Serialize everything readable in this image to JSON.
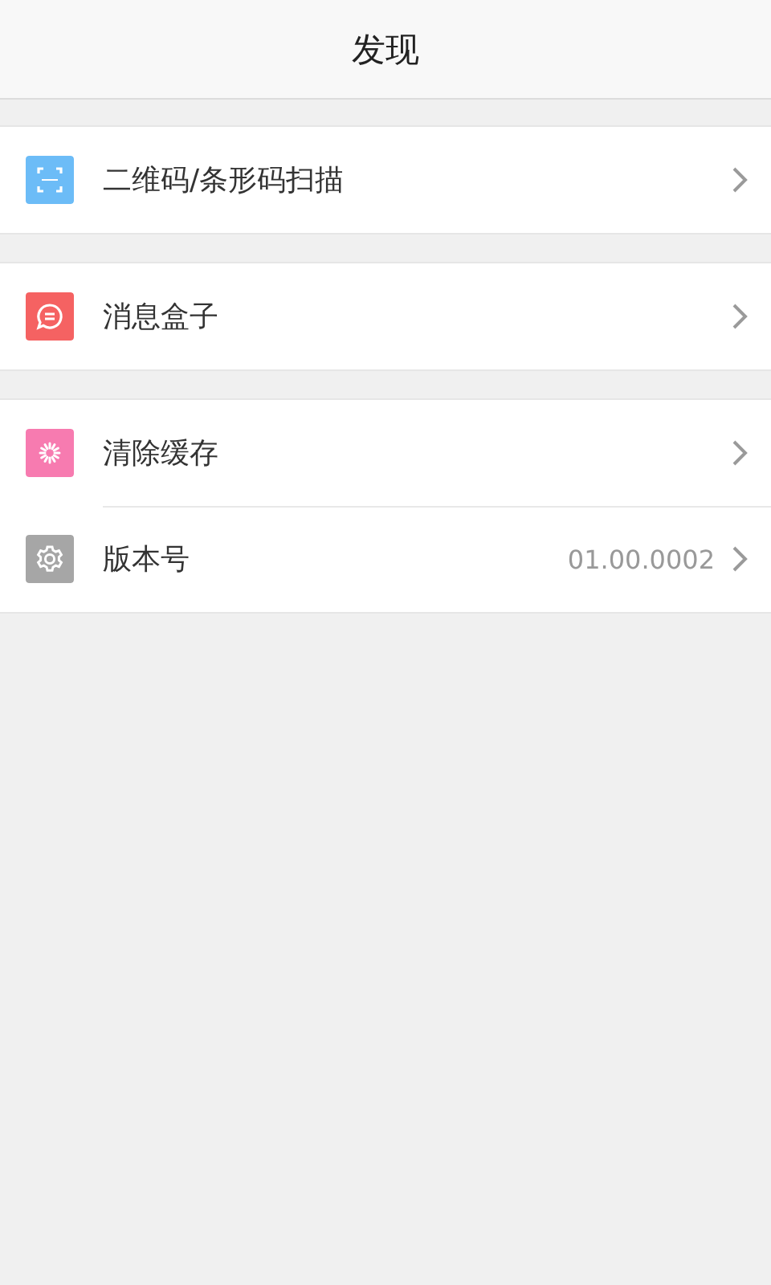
{
  "header": {
    "title": "发现"
  },
  "groups": [
    {
      "items": [
        {
          "kind": "scan",
          "label": "二维码/条形码扫描"
        }
      ]
    },
    {
      "items": [
        {
          "kind": "message",
          "label": "消息盒子"
        }
      ]
    },
    {
      "items": [
        {
          "kind": "clean",
          "label": "清除缓存"
        },
        {
          "kind": "settings",
          "label": "版本号",
          "value": "01.00.0002"
        }
      ]
    }
  ]
}
